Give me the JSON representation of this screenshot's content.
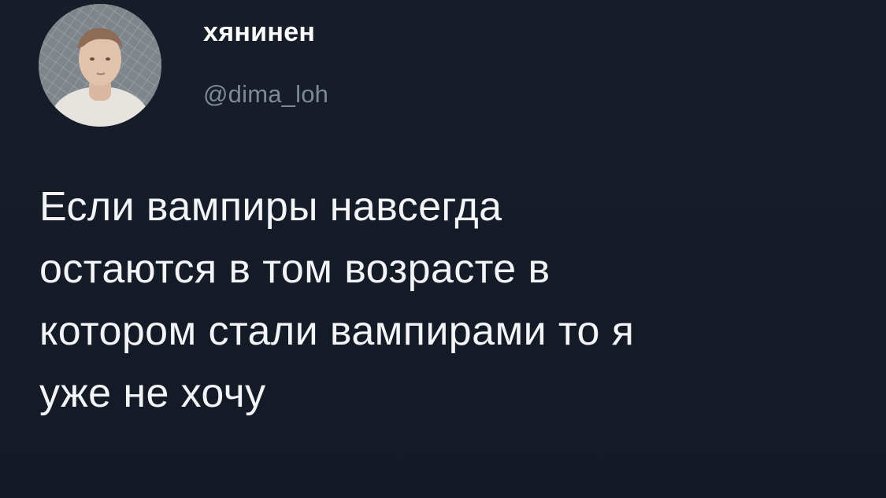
{
  "user": {
    "display_name": "хянинен",
    "handle": "@dima_loh",
    "avatar_icon": "person-avatar-photo"
  },
  "tweet": {
    "lines": [
      "Если вампиры навсегда",
      "остаются в том возрасте в",
      "котором стали вампирами то я",
      "уже не хочу"
    ]
  },
  "colors": {
    "background": "#151b26",
    "text": "#f2f4f7",
    "handle": "#7f8a96"
  }
}
